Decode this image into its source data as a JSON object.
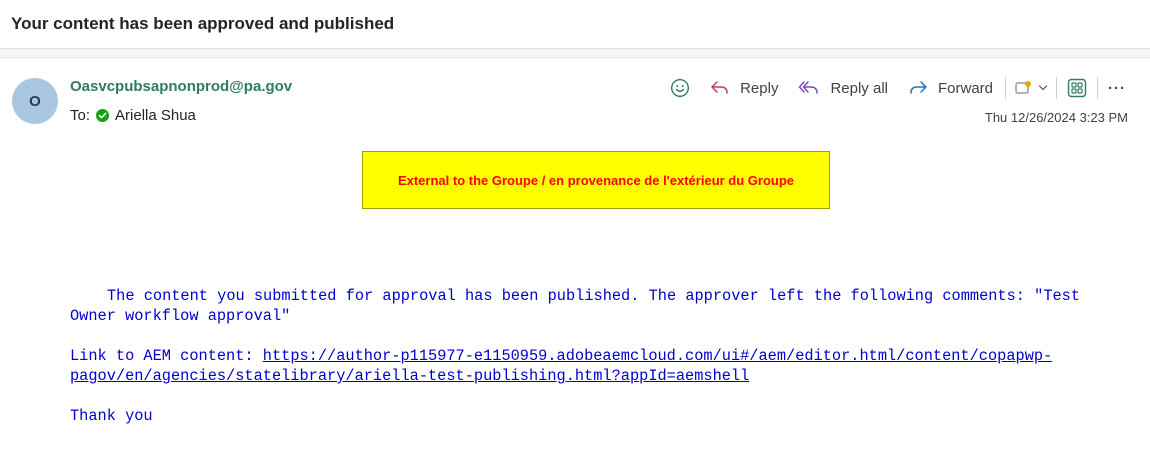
{
  "email": {
    "subject": "Your content has been approved and published",
    "sender": "Oasvcpubsapnonprod@pa.gov",
    "avatar_initial": "O",
    "to_label": "To:",
    "recipient": "Ariella Shua",
    "timestamp": "Thu 12/26/2024 3:23 PM"
  },
  "toolbar": {
    "reply_label": "Reply",
    "reply_all_label": "Reply all",
    "forward_label": "Forward",
    "more_label": "···"
  },
  "banner": {
    "text": "External to the Groupe / en provenance de l'extérieur du Groupe"
  },
  "body": {
    "line1": "The content you submitted for approval has been published. The approver left the following comments: \"Test",
    "line2": "Owner workflow approval\"",
    "link_label": "Link to AEM content: ",
    "link_line1": "https://author-p115977-e1150959.adobeaemcloud.com/ui#/aem/editor.html/content/copapwp-",
    "link_line2": "pagov/en/agencies/statelibrary/ariella-test-publishing.html?appId=aemshell",
    "closing": "Thank you"
  },
  "colors": {
    "sender": "#2e7d5b",
    "body_text": "#0000cc",
    "banner_bg": "#ffff00",
    "banner_text": "#ff0000",
    "presence": "#13a10e",
    "avatar_bg": "#a9c7e0"
  }
}
